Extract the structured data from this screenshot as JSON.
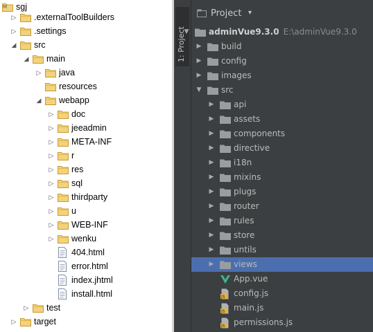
{
  "left_tree": {
    "items": [
      {
        "label": "sgj",
        "type": "project",
        "toggle": "open"
      },
      {
        "label": ".externalToolBuilders",
        "type": "folder",
        "toggle": "closed"
      },
      {
        "label": ".settings",
        "type": "folder",
        "toggle": "closed"
      },
      {
        "label": "src",
        "type": "folder",
        "toggle": "open"
      },
      {
        "label": "main",
        "type": "folder",
        "toggle": "open"
      },
      {
        "label": "java",
        "type": "folder",
        "toggle": "closed"
      },
      {
        "label": "resources",
        "type": "folder",
        "toggle": "none"
      },
      {
        "label": "webapp",
        "type": "folder",
        "toggle": "open"
      },
      {
        "label": "doc",
        "type": "folder",
        "toggle": "closed"
      },
      {
        "label": "jeeadmin",
        "type": "folder",
        "toggle": "closed"
      },
      {
        "label": "META-INF",
        "type": "folder",
        "toggle": "closed"
      },
      {
        "label": "r",
        "type": "folder",
        "toggle": "closed"
      },
      {
        "label": "res",
        "type": "folder",
        "toggle": "closed"
      },
      {
        "label": "sql",
        "type": "folder",
        "toggle": "closed"
      },
      {
        "label": "thirdparty",
        "type": "folder",
        "toggle": "closed"
      },
      {
        "label": "u",
        "type": "folder",
        "toggle": "closed"
      },
      {
        "label": "WEB-INF",
        "type": "folder",
        "toggle": "closed"
      },
      {
        "label": "wenku",
        "type": "folder",
        "toggle": "closed"
      },
      {
        "label": "404.html",
        "type": "file",
        "toggle": "none"
      },
      {
        "label": "error.html",
        "type": "file",
        "toggle": "none"
      },
      {
        "label": "index.jhtml",
        "type": "file",
        "toggle": "none"
      },
      {
        "label": "install.html",
        "type": "file",
        "toggle": "none"
      },
      {
        "label": "test",
        "type": "folder",
        "toggle": "closed"
      },
      {
        "label": "target",
        "type": "folder",
        "toggle": "closed"
      }
    ]
  },
  "right_panel": {
    "side_tab": "1: Project",
    "header": {
      "title": "Project",
      "dropdown": "▾",
      "settings": "⊕"
    },
    "items": [
      {
        "label": "adminVue9.3.0",
        "path": "E:\\adminVue9.3.0",
        "type": "folder",
        "toggle": "open",
        "bold": true
      },
      {
        "label": "build",
        "type": "folder",
        "toggle": "closed"
      },
      {
        "label": "config",
        "type": "folder",
        "toggle": "closed"
      },
      {
        "label": "images",
        "type": "folder",
        "toggle": "closed"
      },
      {
        "label": "src",
        "type": "folder",
        "toggle": "open"
      },
      {
        "label": "api",
        "type": "folder",
        "toggle": "closed"
      },
      {
        "label": "assets",
        "type": "folder",
        "toggle": "closed"
      },
      {
        "label": "components",
        "type": "folder",
        "toggle": "closed"
      },
      {
        "label": "directive",
        "type": "folder",
        "toggle": "closed"
      },
      {
        "label": "i18n",
        "type": "folder",
        "toggle": "closed"
      },
      {
        "label": "mixins",
        "type": "folder",
        "toggle": "closed"
      },
      {
        "label": "plugs",
        "type": "folder",
        "toggle": "closed"
      },
      {
        "label": "router",
        "type": "folder",
        "toggle": "closed"
      },
      {
        "label": "rules",
        "type": "folder",
        "toggle": "closed"
      },
      {
        "label": "store",
        "type": "folder",
        "toggle": "closed"
      },
      {
        "label": "untils",
        "type": "folder",
        "toggle": "closed"
      },
      {
        "label": "views",
        "type": "folder",
        "toggle": "closed",
        "selected": true
      },
      {
        "label": "App.vue",
        "type": "vue",
        "toggle": "none"
      },
      {
        "label": "config.js",
        "type": "js",
        "toggle": "none"
      },
      {
        "label": "main.js",
        "type": "js",
        "toggle": "none"
      },
      {
        "label": "permissions.js",
        "type": "js",
        "toggle": "none"
      }
    ]
  },
  "colors": {
    "eclipse_folder": "#e8b74a",
    "intellij_bg": "#3c3f41",
    "intellij_selection": "#4b6eaf",
    "intellij_folder": "#9a9da0",
    "vue_green": "#41b883"
  }
}
